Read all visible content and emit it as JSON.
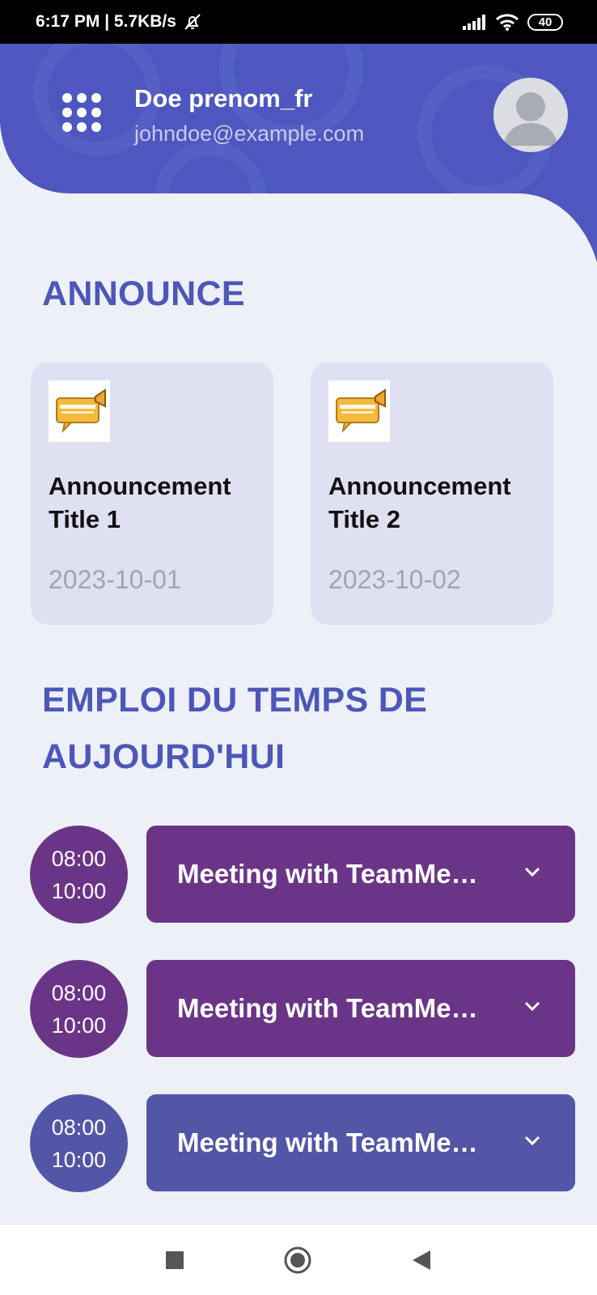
{
  "status_bar": {
    "time_speed": "6:17 PM | 5.7KB/s",
    "battery": "40",
    "icons": [
      "bell-off-icon",
      "signal-icon",
      "wifi-icon",
      "battery-icon"
    ]
  },
  "header": {
    "menu_icon": "grid-menu-icon",
    "user_name": "Doe prenom_fr",
    "user_email": "johndoe@example.com",
    "avatar_icon": "avatar-icon",
    "colors": {
      "primary": "#4d57bf",
      "accent_text": "#c6cbee"
    }
  },
  "announcements": {
    "title": "ANNOUNCE",
    "items": [
      {
        "title": "Announcement Title 1",
        "date": "2023-10-01",
        "icon": "important-announcement-icon"
      },
      {
        "title": "Announcement Title 2",
        "date": "2023-10-02",
        "icon": "important-announcement-icon"
      }
    ]
  },
  "schedule": {
    "title_line1": "EMPLOI DU TEMPS DE",
    "title_line2": "AUJOURD'HUI",
    "items": [
      {
        "start": "08:00",
        "end": "10:00",
        "title": "Meeting with TeamMe…",
        "color": "#6b3587"
      },
      {
        "start": "08:00",
        "end": "10:00",
        "title": "Meeting with TeamMe…",
        "color": "#6b3587"
      },
      {
        "start": "08:00",
        "end": "10:00",
        "title": "Meeting with TeamMe…",
        "color": "#5356a6"
      }
    ]
  },
  "nav": {
    "icons": [
      "recents-square-icon",
      "home-circle-icon",
      "back-triangle-icon"
    ]
  }
}
